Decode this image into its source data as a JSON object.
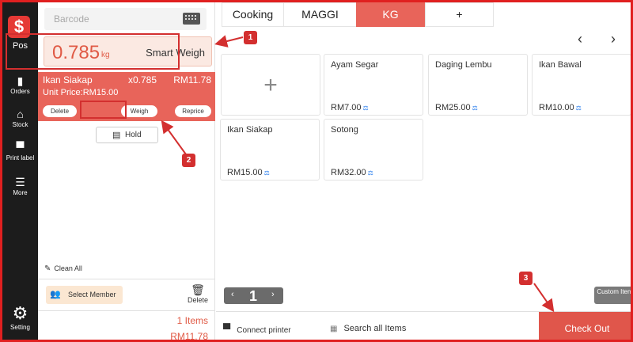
{
  "sidebar": {
    "logo_glyph": "$",
    "logo_label": "Pos",
    "items": [
      {
        "label": "Orders",
        "icon": "orders-icon"
      },
      {
        "label": "Stock",
        "icon": "home-icon"
      },
      {
        "label": "Print label",
        "icon": "printer-icon"
      },
      {
        "label": "More",
        "icon": "menu-icon"
      }
    ],
    "settings_label": "Setting"
  },
  "left_panel": {
    "barcode_placeholder": "Barcode",
    "weight_value": "0.785",
    "weight_unit": "kg",
    "smart_weigh_label": "Smart Weigh",
    "cart_item": {
      "name": "Ikan Siakap",
      "qty": "x0.785",
      "price": "RM11.78",
      "unit_price": "Unit Price:RM15.00",
      "delete_label": "Delete",
      "weigh_label": "Weigh",
      "reprice_label": "Reprice"
    },
    "hold_label": "Hold",
    "clean_all_label": "Clean All",
    "select_member_label": "Select Member",
    "delete_label": "Delete",
    "items_count": "1 Items",
    "total": "RM11.78"
  },
  "tabs": [
    "Cooking",
    "MAGGI",
    "KG",
    "+"
  ],
  "active_tab": "KG",
  "nav": {
    "prev": "‹",
    "next": "›"
  },
  "products": [
    {
      "name": "Ayam Segar",
      "price": "RM7.00"
    },
    {
      "name": "Daging Lembu",
      "price": "RM25.00"
    },
    {
      "name": "Ikan Bawal",
      "price": "RM10.00"
    },
    {
      "name": "Ikan Siakap",
      "price": "RM15.00"
    },
    {
      "name": "Sotong",
      "price": "RM32.00"
    }
  ],
  "add_card_glyph": "+",
  "pager": {
    "page": "1"
  },
  "custom_item_label": "Custom Item",
  "bottom": {
    "connect_printer": "Connect printer",
    "search_all": "Search all Items",
    "checkout": "Check Out"
  },
  "annotations": [
    "1",
    "2",
    "3"
  ],
  "colors": {
    "accent": "#e8645a",
    "sidebar_bg": "#1c1c1c",
    "annotation": "#d32f2f"
  }
}
